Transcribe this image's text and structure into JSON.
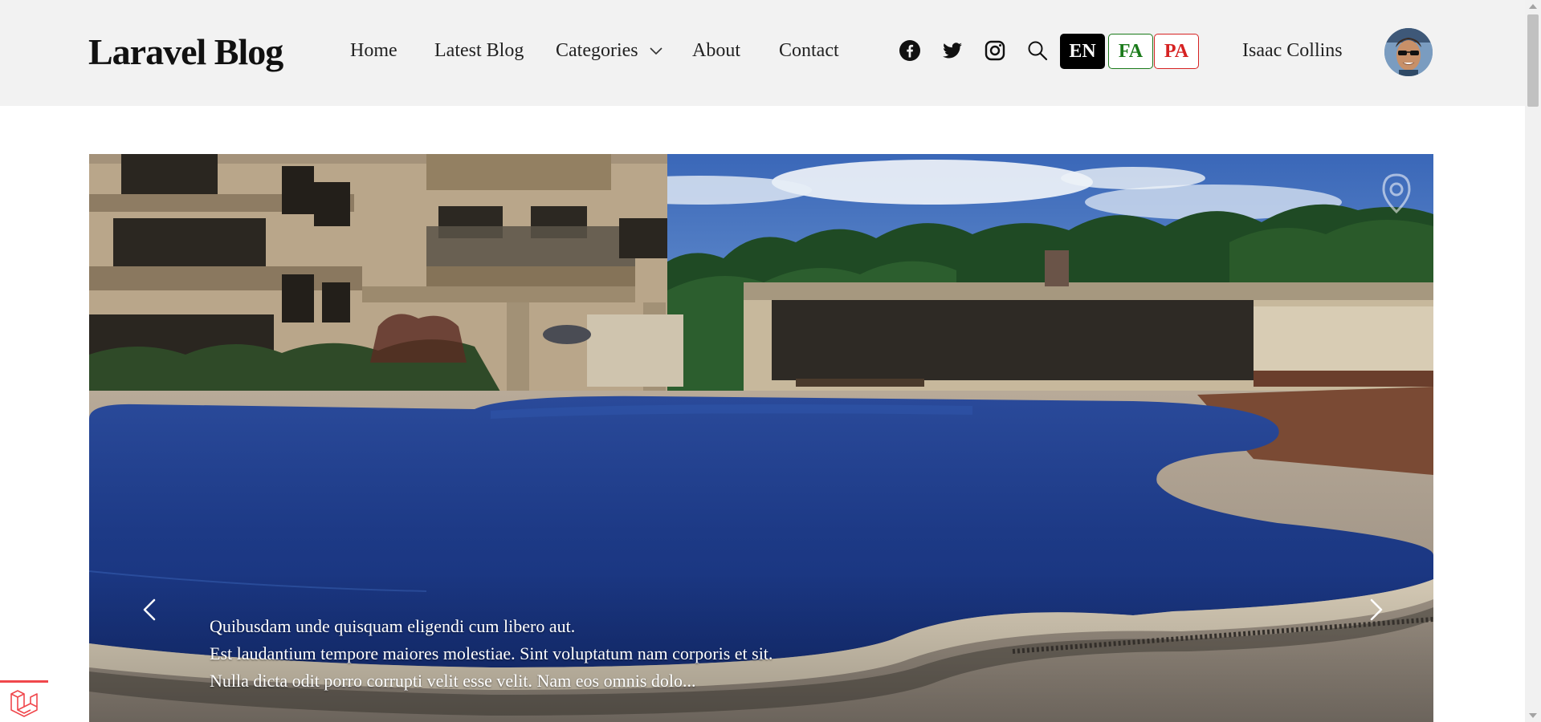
{
  "site": {
    "logo": "Laravel Blog"
  },
  "nav": {
    "items": [
      {
        "label": "Home"
      },
      {
        "label": "Latest Blog"
      },
      {
        "label": "Categories"
      },
      {
        "label": "About"
      },
      {
        "label": "Contact"
      }
    ]
  },
  "social": {
    "icons": [
      "facebook-icon",
      "twitter-icon",
      "instagram-icon",
      "search-icon"
    ]
  },
  "languages": [
    {
      "label": "EN",
      "color": "#000000",
      "active": true
    },
    {
      "label": "FA",
      "color": "#1a7a1a",
      "active": false
    },
    {
      "label": "PA",
      "color": "#d62222",
      "active": false
    }
  ],
  "user": {
    "name": "Isaac Collins"
  },
  "slider": {
    "caption": {
      "line1": "Quibusdam unde quisquam eligendi cum libero aut.",
      "line2": "Est laudantium tempore maiores molestiae. Sint voluptatum nam corporis et sit.",
      "line3": "Nulla dicta odit porro corrupti velit esse velit. Nam eos omnis dolo..."
    }
  },
  "colors": {
    "header_bg": "#f2f2f2",
    "accent_red": "#f0474c"
  }
}
